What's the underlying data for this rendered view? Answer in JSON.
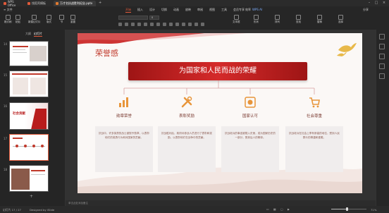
{
  "titlebar": {
    "tabs": [
      {
        "label": "WPS Office",
        "color": "#e05a3a"
      },
      {
        "label": "找稻壳模板",
        "color": "#e05a3a"
      },
      {
        "label": "万才名抗战胜利纪念.pptx",
        "color": "#e07a30"
      }
    ],
    "new_tab": "+"
  },
  "menu": {
    "file": "≡ 文件",
    "items": [
      "开始",
      "插入",
      "设计",
      "切换",
      "动画",
      "放映",
      "审阅",
      "视图",
      "工具",
      "会员专享",
      "效率"
    ],
    "active": "开始",
    "wps_ai": "WPS AI",
    "share": "分享"
  },
  "ribbon": {
    "buttons": [
      "格式刷",
      "粘贴",
      "新建幻灯片",
      "版式",
      "节",
      "重置"
    ],
    "font_name": "",
    "font_size": "0",
    "right_buttons": [
      "文本框",
      "形状",
      "排列",
      "查找",
      "替换",
      "选择"
    ]
  },
  "leftpanel": {
    "tabs": [
      "大纲",
      "幻灯片"
    ],
    "active_tab": "幻灯片",
    "slide_numbers": [
      "14",
      "15",
      "16",
      "17",
      "18"
    ],
    "thumb16_title": "社会贡献",
    "add_button": "+"
  },
  "slide": {
    "heading": "荣誉感",
    "banner": "为国家和人民而战的荣耀",
    "cards": [
      {
        "title": "勋章荣誉",
        "icon": "chart-bars-icon",
        "text": "抗战中，许多英勇的战士被授予勋章，以表彰他们的英勇行为和对国家的贡献。"
      },
      {
        "title": "表彰奖励",
        "icon": "tools-icon",
        "text": "抗战胜利后，政府对参战人员进行了表彰和奖励，以表彰他们在战争中的贡献。"
      },
      {
        "title": "国家认可",
        "icon": "medal-icon",
        "text": "抗战老兵的事迹被载入史册，成为国家历史的一部分，受到后人的敬仰。"
      },
      {
        "title": "社会尊重",
        "icon": "cart-icon",
        "text": "抗战老兵在社会上享有崇高的地位，受到人民群众的尊重和爱戴。"
      }
    ],
    "colors": {
      "accent": "#b81c1c",
      "heading": "#c0392b"
    }
  },
  "notes": {
    "placeholder": "单击此处添加备注"
  },
  "status": {
    "slide_info": "幻灯片 17 / 27",
    "theme": "Designed by iSlide",
    "zoom": "71%",
    "progress": 0.45
  }
}
